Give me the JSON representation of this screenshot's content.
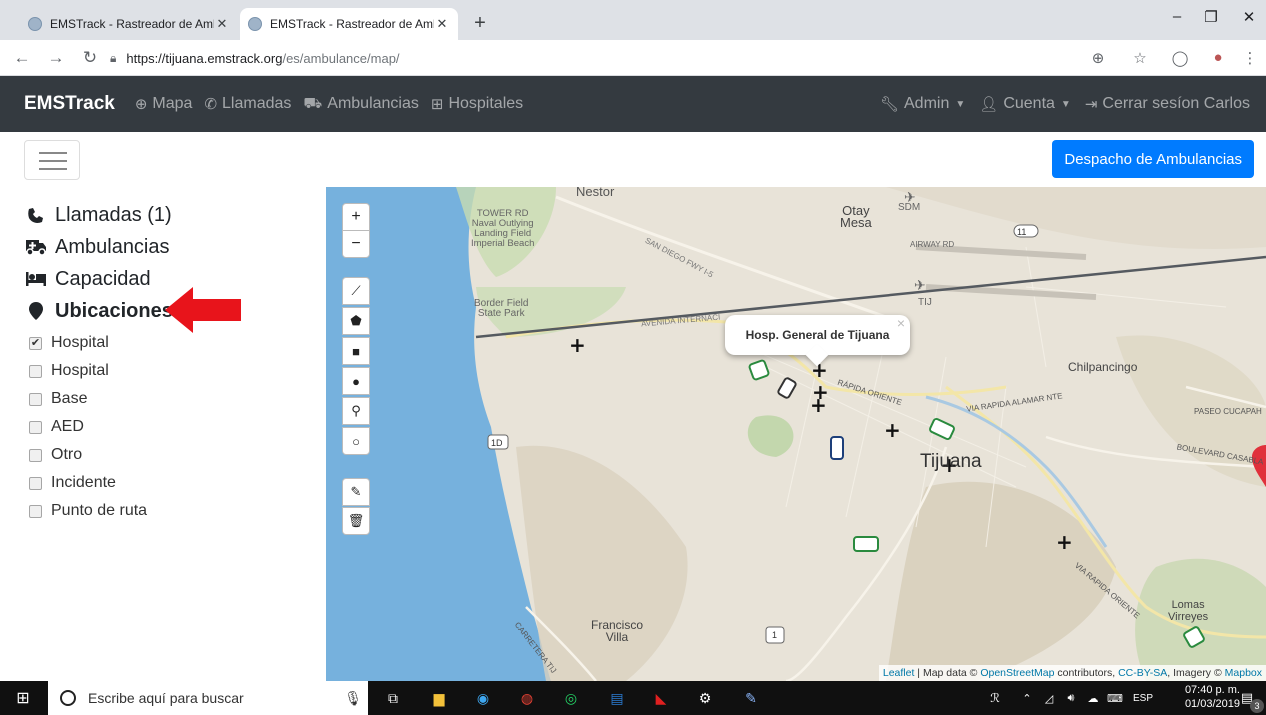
{
  "browser": {
    "tabs": [
      {
        "title": "EMSTrack - Rastreador de Ambul",
        "close": "✕"
      },
      {
        "title": "EMSTrack - Rastreador de Ambul",
        "close": "✕"
      }
    ],
    "new_tab": "+",
    "url_host": "https://tijuana.emstrack.org",
    "url_path": "/es/ambulance/map/"
  },
  "app": {
    "brand": "EMSTrack",
    "nav": [
      {
        "icon": "globe-icon",
        "label": "Mapa"
      },
      {
        "icon": "phone-icon",
        "label": "Llamadas"
      },
      {
        "icon": "ambulance-icon",
        "label": "Ambulancias"
      },
      {
        "icon": "hospital-icon",
        "label": "Hospitales"
      }
    ],
    "nav_right": [
      {
        "icon": "wrench-icon",
        "label": "Admin",
        "caret": true
      },
      {
        "icon": "user-icon",
        "label": "Cuenta",
        "caret": true
      },
      {
        "icon": "sign-out-icon",
        "label": "Cerrar sesíon Carlos",
        "caret": false
      }
    ],
    "dispatch_button": "Despacho de Ambulancias"
  },
  "sidebar": {
    "sections": [
      {
        "icon": "phone-icon",
        "label": "Llamadas (1)"
      },
      {
        "icon": "ambulance-icon",
        "label": "Ambulancias"
      },
      {
        "icon": "bed-icon",
        "label": "Capacidad"
      },
      {
        "icon": "map-marker-icon",
        "label": "Ubicaciones"
      }
    ],
    "location_filters": [
      {
        "label": "Hospital",
        "checked": true
      },
      {
        "label": "Hospital",
        "checked": false
      },
      {
        "label": "Base",
        "checked": false
      },
      {
        "label": "AED",
        "checked": false
      },
      {
        "label": "Otro",
        "checked": false
      },
      {
        "label": "Incidente",
        "checked": false
      },
      {
        "label": "Punto de ruta",
        "checked": false
      }
    ],
    "annotation_arrow_color": "#e8141b"
  },
  "map": {
    "zoom_in": "+",
    "zoom_out": "−",
    "popup_title": "Hosp. General de Tijuana",
    "popup_close": "×",
    "labels": {
      "nestor": "Nestor",
      "otay_mesa": "Otay\nMesa",
      "sdm": "SDM",
      "tower_rd": "TOWER RD\nNaval Outlying\nLanding Field\nImperial Beach",
      "airway_rd": "AIRWAY RD",
      "san_diego_fwy": "SAN DIEGO FWY I-5",
      "border_field": "Border Field\nState Park",
      "avenida_internacional": "AVENIDA INTERNACI",
      "tij": "TIJ",
      "chilpancingo": "Chilpancingo",
      "rapida_oriente": "RÁPIDA ORIENTE",
      "via_rapida_alamar": "VIA RAPIDA ALAMAR NTE",
      "paseo_cucapah": "PASEO CUCAPAH",
      "boulevard_casablanca": "BOULEVARD CASABLA",
      "tijuana": "Tijuana",
      "via_rapida_oriente": "VIA RAPIDA ORIENTE",
      "francisco_villa": "Francisco\nVilla",
      "lomas_virreyes": "Lomas\nVirreyes",
      "carretera": "CARRETERA TIJ",
      "shield_11": "11",
      "shield_1d": "1D",
      "shield_1": "1"
    },
    "attribution": {
      "leaflet": "Leaflet",
      "text1": " | Map data © ",
      "osm": "OpenStreetMap",
      "text2": " contributors, ",
      "license": "CC-BY-SA",
      "text3": ", Imagery © ",
      "mapbox": "Mapbox"
    }
  },
  "taskbar": {
    "search_placeholder": "Escribe aquí para buscar",
    "language": "ESP",
    "time": "07:40 p. m.",
    "date": "01/03/2019",
    "notification_count": "3"
  }
}
